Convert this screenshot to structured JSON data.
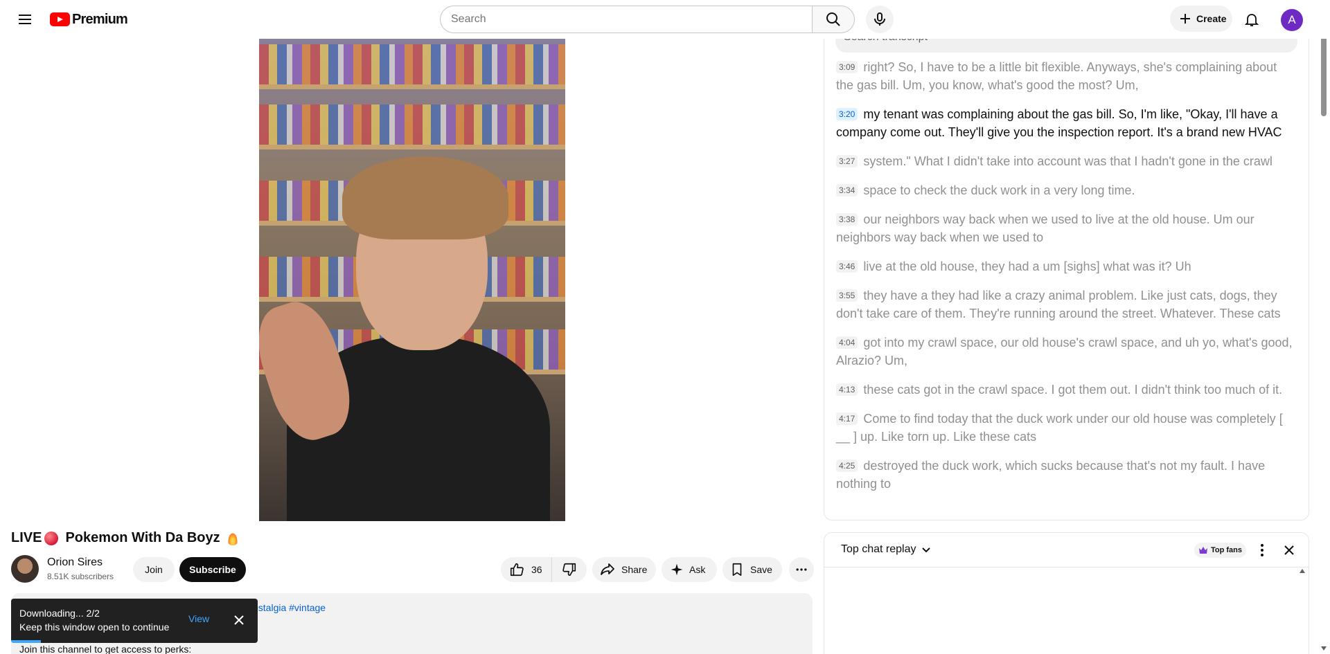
{
  "header": {
    "logo_text": "Premium",
    "search_placeholder": "Search",
    "create_label": "Create",
    "avatar_letter": "A"
  },
  "video": {
    "title_prefix": "LIVE",
    "title_main": "Pokemon With Da Boyz"
  },
  "channel": {
    "name": "Orion Sires",
    "subscribers": "8.51K subscribers",
    "join_label": "Join",
    "subscribe_label": "Subscribe"
  },
  "actions": {
    "like_count": "36",
    "share_label": "Share",
    "ask_label": "Ask",
    "save_label": "Save"
  },
  "description": {
    "tags": "ostalgia #vintage",
    "line": "Join this channel to get access to perks:"
  },
  "toast": {
    "line1": "Downloading... 2/2",
    "line2": "Keep this window open to continue",
    "view_label": "View",
    "progress": 0.12
  },
  "transcript": {
    "search_placeholder": "Search transcript",
    "segments": [
      {
        "time": "3:09",
        "text": "right? So, I have to be a little bit flexible. Anyways, she's complaining about the gas bill. Um, you know, what's good the most? Um,"
      },
      {
        "time": "3:20",
        "text": "my tenant was complaining about the gas bill. So, I'm like, \"Okay, I'll have a company come out. They'll give you the inspection report. It's a brand new HVAC"
      },
      {
        "time": "3:27",
        "text": "system.\" What I didn't take into account was that I hadn't gone in the crawl"
      },
      {
        "time": "3:34",
        "text": "space to check the duck work in a very long time."
      },
      {
        "time": "3:38",
        "text": "our neighbors way back when we used to live at the old house. Um our neighbors way back when we used to"
      },
      {
        "time": "3:46",
        "text": "live at the old house, they had a um [sighs] what was it? Uh"
      },
      {
        "time": "3:55",
        "text": "they have a they had like a crazy animal problem. Like just cats, dogs, they don't take care of them. They're running around the street. Whatever. These cats"
      },
      {
        "time": "4:04",
        "text": "got into my crawl space, our old house's crawl space, and uh yo, what's good, Alrazio? Um,"
      },
      {
        "time": "4:13",
        "text": "these cats got in the crawl space. I got them out. I didn't think too much of it."
      },
      {
        "time": "4:17",
        "text": "Come to find today that the duck work under our old house was completely [ __ ] up. Like torn up. Like these cats"
      },
      {
        "time": "4:25",
        "text": "destroyed the duck work, which sucks because that's not my fault. I have nothing to"
      }
    ],
    "active_index": 1
  },
  "chat": {
    "title": "Top chat replay",
    "top_fans_label": "Top fans"
  },
  "colors": {
    "brand_red": "#ff0000",
    "link_blue": "#065fd4",
    "toast_accent": "#3ea6ff",
    "avatar_purple": "#6e2ac3"
  },
  "icons": [
    "menu-icon",
    "search-icon",
    "mic-icon",
    "plus-icon",
    "bell-icon",
    "like-icon",
    "dislike-icon",
    "share-icon",
    "sparkle-icon",
    "bookmark-icon",
    "more-icon",
    "close-icon",
    "chevron-down-icon",
    "crown-icon"
  ]
}
